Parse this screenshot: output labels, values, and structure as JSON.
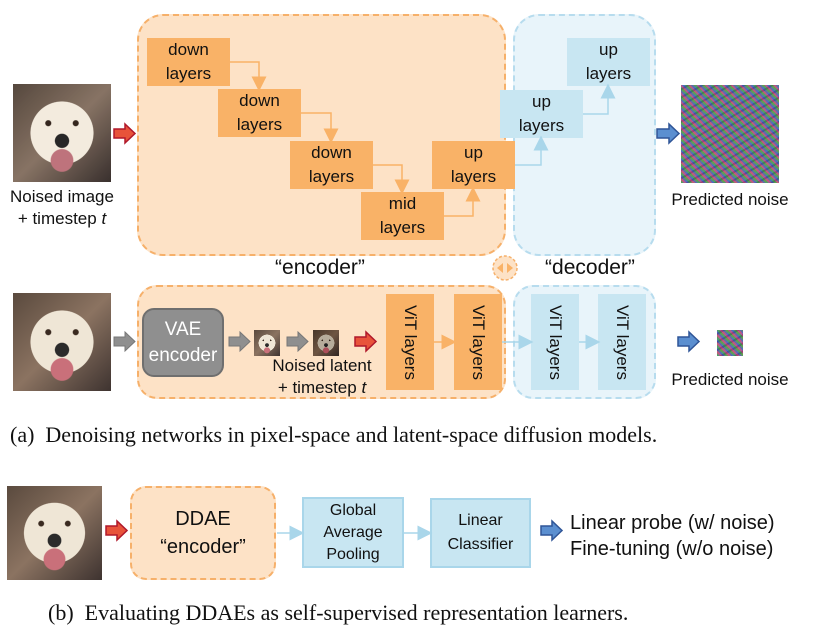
{
  "part_a": {
    "row1": {
      "input_label_line1": "Noised image",
      "input_label_line2_prefix": "+ timestep ",
      "input_label_var": "t",
      "encoder_blocks": [
        {
          "line1": "down",
          "line2": "layers"
        },
        {
          "line1": "down",
          "line2": "layers"
        },
        {
          "line1": "down",
          "line2": "layers"
        },
        {
          "line1": "mid",
          "line2": "layers"
        },
        {
          "line1": "up",
          "line2": "layers"
        }
      ],
      "decoder_blocks": [
        {
          "line1": "up",
          "line2": "layers"
        },
        {
          "line1": "up",
          "line2": "layers"
        }
      ],
      "output_label": "Predicted noise"
    },
    "encoder_label": "“encoder”",
    "decoder_label": "“decoder”",
    "row2": {
      "vae_line1": "VAE",
      "vae_line2": "encoder",
      "latent_label_line1": "Noised latent",
      "latent_label_line2_prefix": "+ timestep ",
      "latent_label_var": "t",
      "vit_blocks": [
        "ViT layers",
        "ViT layers",
        "ViT layers",
        "ViT layers"
      ],
      "output_label": "Predicted noise"
    },
    "caption": "(a) Denoising networks in pixel-space and latent-space diffusion models."
  },
  "part_b": {
    "ddae_line1": "DDAE",
    "ddae_line2": "“encoder”",
    "gap_lines": [
      "Global",
      "Average",
      "Pooling"
    ],
    "classifier_lines": [
      "Linear",
      "Classifier"
    ],
    "outputs": [
      "Linear probe (w/ noise)",
      "Fine-tuning (w/o noise)"
    ],
    "caption": "(b) Evaluating DDAEs as self-supervised representation learners."
  },
  "colors": {
    "encoder_fill": "#fde2c6",
    "encoder_border": "#f6b06a",
    "encoder_block": "#f9b267",
    "decoder_fill": "#e8f4fa",
    "decoder_border": "#b7dcee",
    "decoder_block": "#c8e6f2",
    "red_arrow": "#e8533a",
    "blue_arrow": "#5b8fd0",
    "gray_arrow": "#8f8f8f"
  }
}
